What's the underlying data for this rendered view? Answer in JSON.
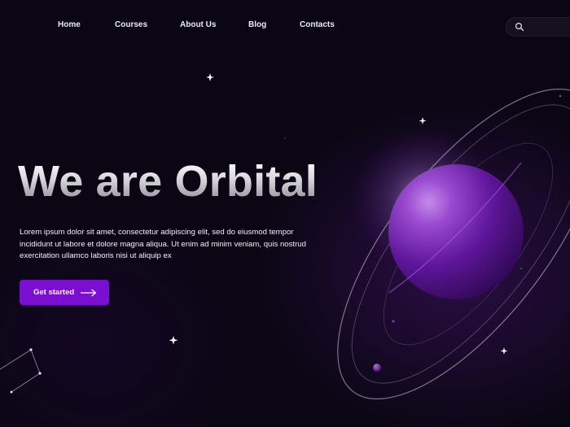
{
  "nav": {
    "items": [
      {
        "label": "Home"
      },
      {
        "label": "Courses"
      },
      {
        "label": "About Us"
      },
      {
        "label": "Blog"
      },
      {
        "label": "Contacts"
      }
    ]
  },
  "search": {
    "icon": "search-icon",
    "value": ""
  },
  "hero": {
    "title": "We are Orbital",
    "description": "Lorem ipsum dolor sit amet, consectetur adipiscing elit, sed do eiusmod tempor incididunt ut labore et dolore magna aliqua. Ut enim ad minim veniam, quis nostrud exercitation ullamco laboris nisi ut aliquip ex",
    "cta_label": "Get started",
    "cta_icon": "arrow-right-icon"
  },
  "colors": {
    "background": "#0a0613",
    "accent": "#7a0ed1",
    "planet": "#5a1494",
    "orbit": "#c9bfd9"
  }
}
